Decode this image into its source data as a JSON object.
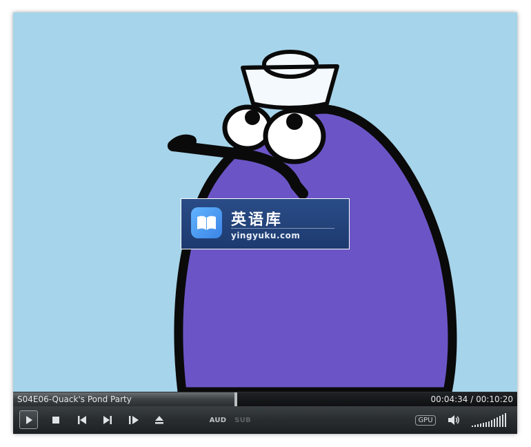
{
  "player": {
    "file_name": "S04E06-Quack's Pond Party",
    "time_display": "00:04:34 / 00:10:20",
    "progress_fraction": 0.442
  },
  "watermark": {
    "title": "英语库",
    "url": "yingyuku.com"
  },
  "controls": {
    "audio_label": "AUD",
    "subtitle_label": "SUB",
    "gpu_label": "GPU",
    "volume_level_fraction": 1.0
  },
  "colors": {
    "video_background": "#a6d4ea",
    "character_body": "#6b55c6",
    "watermark_bg": "#1d3a6f"
  },
  "icons": [
    "play-icon",
    "stop-icon",
    "previous-icon",
    "next-icon",
    "frame-step-icon",
    "eject-icon",
    "speaker-icon",
    "volume-bars-icon",
    "book-icon"
  ]
}
